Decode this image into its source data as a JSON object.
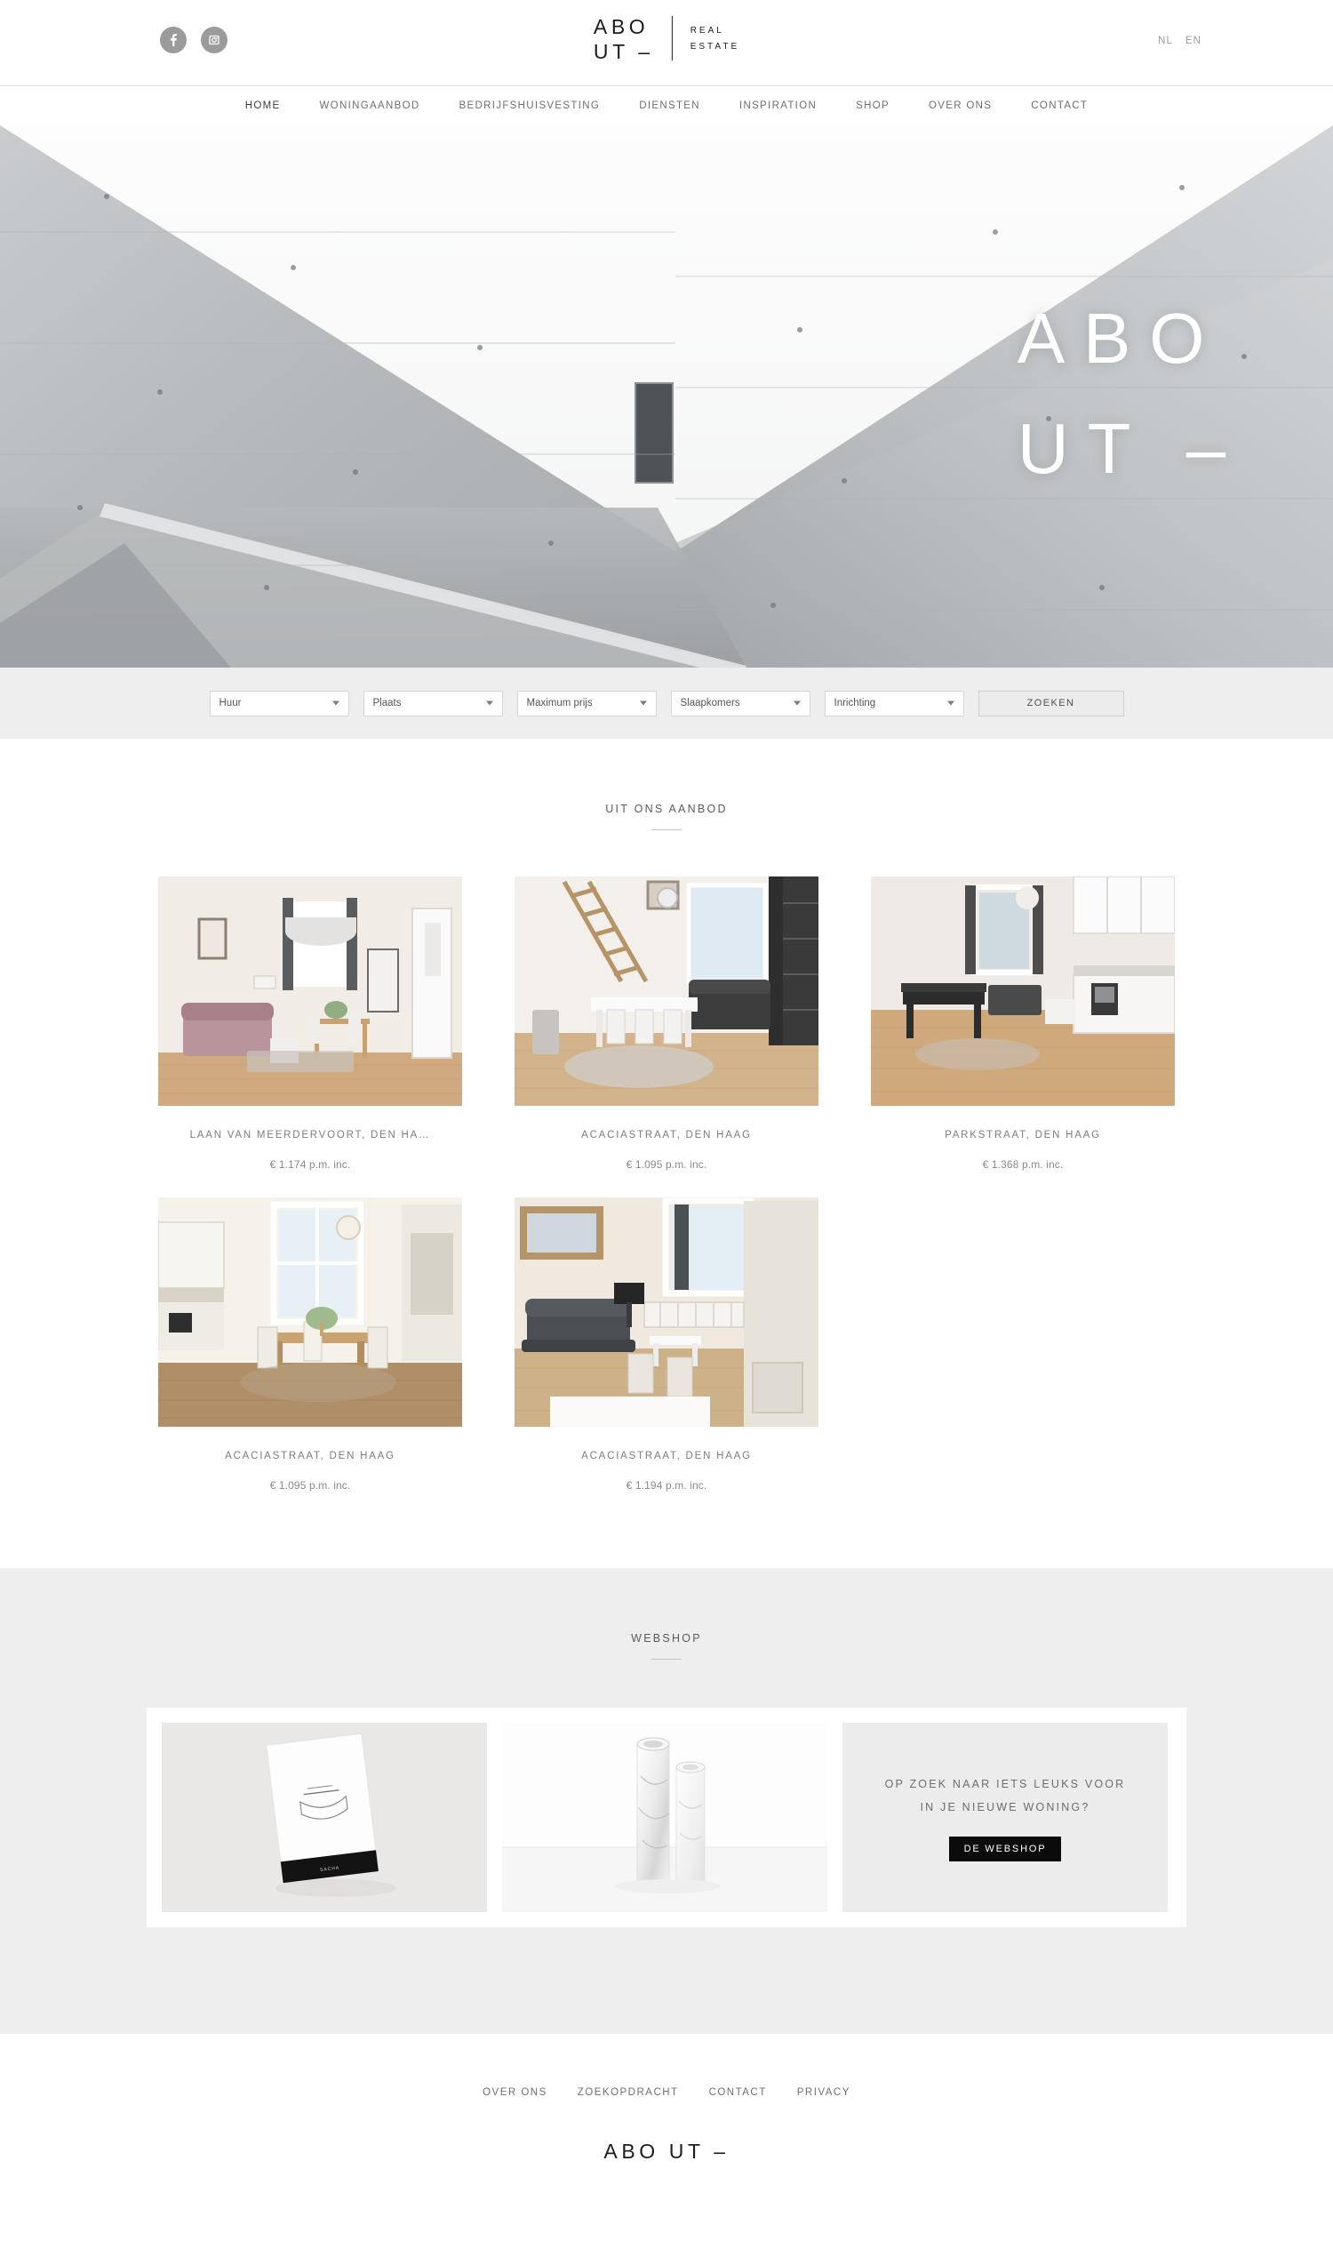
{
  "header": {
    "logo": {
      "line1": "ABO",
      "line2": "UT –",
      "sub1": "REAL",
      "sub2": "ESTATE"
    },
    "social": [
      {
        "name": "facebook-icon",
        "label": "f"
      },
      {
        "name": "instagram-icon",
        "label": "ig"
      }
    ],
    "languages": [
      {
        "code": "NL"
      },
      {
        "code": "EN"
      }
    ]
  },
  "nav": {
    "items": [
      {
        "label": "HOME",
        "active": true
      },
      {
        "label": "WONINGAANBOD",
        "active": false
      },
      {
        "label": "BEDRIJFSHUISVESTING",
        "active": false
      },
      {
        "label": "DIENSTEN",
        "active": false
      },
      {
        "label": "INSPIRATION",
        "active": false
      },
      {
        "label": "SHOP",
        "active": false
      },
      {
        "label": "OVER ONS",
        "active": false
      },
      {
        "label": "CONTACT",
        "active": false
      }
    ]
  },
  "hero": {
    "overlay_line1": "ABO",
    "overlay_line2": "UT –",
    "image_description": "concrete-architecture-photo"
  },
  "search": {
    "filters": [
      {
        "label": "Huur"
      },
      {
        "label": "Plaats"
      },
      {
        "label": "Maximum prijs"
      },
      {
        "label": "Slaapkomers"
      },
      {
        "label": "Inrichting"
      }
    ],
    "submit_label": "ZOEKEN"
  },
  "listings": {
    "heading": "UIT ONS AANBOD",
    "items": [
      {
        "title": "LAAN VAN MEERDERVOORT, DEN HA…",
        "price": "€ 1.174 p.m. inc.",
        "image": "living-room-pink-sofa"
      },
      {
        "title": "ACACIASTRAAT, DEN HAAG",
        "price": "€ 1.095 p.m. inc.",
        "image": "loft-dining-ladder"
      },
      {
        "title": "PARKSTRAAT, DEN HAAG",
        "price": "€ 1.368 p.m. inc.",
        "image": "studio-kitchen-bed"
      },
      {
        "title": "ACACIASTRAAT, DEN HAAG",
        "price": "€ 1.095 p.m. inc.",
        "image": "kitchen-dining-table"
      },
      {
        "title": "ACACIASTRAAT, DEN HAAG",
        "price": "€ 1.194 p.m. inc.",
        "image": "grey-sofa-livingroom"
      }
    ]
  },
  "webshop": {
    "heading": "WEBSHOP",
    "tiles": [
      {
        "image": "white-box-product"
      },
      {
        "image": "marble-vases-product"
      }
    ],
    "promo": {
      "line1": "OP ZOEK NAAR IETS LEUKS VOOR",
      "line2": "IN JE NIEUWE WONING?",
      "button_label": "DE WEBSHOP"
    }
  },
  "footer": {
    "links": [
      {
        "label": "OVER ONS"
      },
      {
        "label": "ZOEKOPDRACHT"
      },
      {
        "label": "CONTACT"
      },
      {
        "label": "PRIVACY"
      }
    ],
    "logo": {
      "line1": "ABO",
      "line2": "UT –"
    }
  },
  "colors": {
    "accent_dark": "#0b0b0b",
    "text_grey": "#6f6f6f",
    "band_grey": "#eeeeee",
    "social_grey": "#9b9b9b"
  }
}
